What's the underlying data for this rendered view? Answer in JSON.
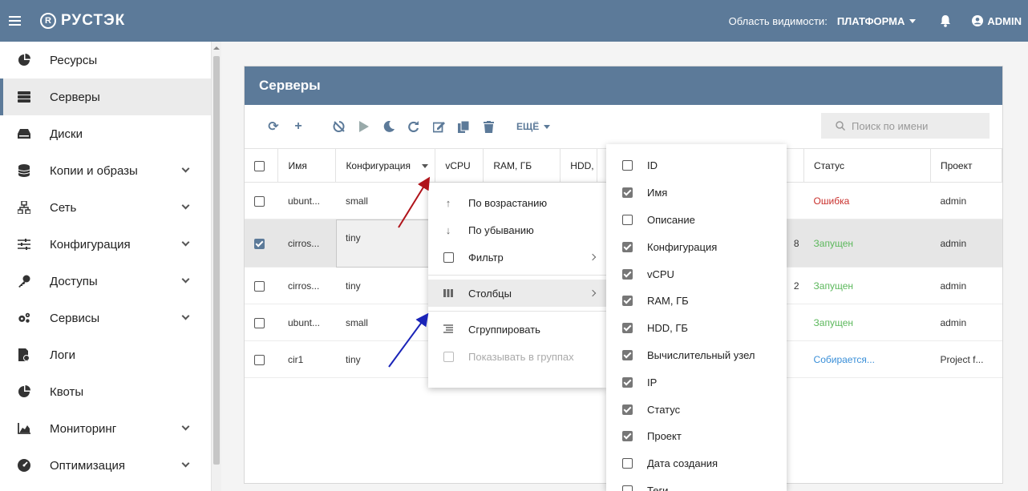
{
  "header": {
    "logo_text": "РУСТЭК",
    "logo_mark": "R",
    "scope_label": "Область видимости:",
    "scope_value": "ПЛАТФОРМА",
    "user": "ADMIN"
  },
  "sidebar": {
    "items": [
      {
        "label": "Ресурсы",
        "icon": "pie-chart-icon",
        "chevron": false
      },
      {
        "label": "Серверы",
        "icon": "server-icon",
        "chevron": false,
        "active": true
      },
      {
        "label": "Диски",
        "icon": "disk-icon",
        "chevron": false
      },
      {
        "label": "Копии и образы",
        "icon": "database-icon",
        "chevron": true
      },
      {
        "label": "Сеть",
        "icon": "network-icon",
        "chevron": true
      },
      {
        "label": "Конфигурация",
        "icon": "sliders-icon",
        "chevron": true
      },
      {
        "label": "Доступы",
        "icon": "key-icon",
        "chevron": true
      },
      {
        "label": "Сервисы",
        "icon": "cogs-icon",
        "chevron": true
      },
      {
        "label": "Логи",
        "icon": "log-icon",
        "chevron": false
      },
      {
        "label": "Квоты",
        "icon": "quota-icon",
        "chevron": false
      },
      {
        "label": "Мониторинг",
        "icon": "chart-icon",
        "chevron": true
      },
      {
        "label": "Оптимизация",
        "icon": "gauge-icon",
        "chevron": true
      }
    ]
  },
  "panel": {
    "title": "Серверы",
    "more_label": "ЕЩЁ",
    "search_placeholder": "Поиск по имени"
  },
  "table": {
    "columns": [
      "Имя",
      "Конфигурация",
      "vCPU",
      "RAM, ГБ",
      "HDD,",
      "Статус",
      "Проект"
    ],
    "rows": [
      {
        "name": "ubunt...",
        "config": "small",
        "partial": "",
        "status": "Ошибка",
        "status_type": "error",
        "project": "admin",
        "checked": false
      },
      {
        "name": "cirros...",
        "config": "tiny",
        "partial": "8",
        "status": "Запущен",
        "status_type": "run",
        "project": "admin",
        "checked": true
      },
      {
        "name": "cirros...",
        "config": "tiny",
        "partial": "2",
        "status": "Запущен",
        "status_type": "run",
        "project": "admin",
        "checked": false
      },
      {
        "name": "ubunt...",
        "config": "small",
        "partial": "",
        "status": "Запущен",
        "status_type": "run",
        "project": "admin",
        "checked": false
      },
      {
        "name": "cir1",
        "config": "tiny",
        "partial": "",
        "status": "Собирается...",
        "status_type": "build",
        "project": "Project f...",
        "checked": false
      }
    ]
  },
  "context_menu": {
    "sort_asc": "По возрастанию",
    "sort_desc": "По убыванию",
    "filter": "Фильтр",
    "columns": "Столбцы",
    "group": "Сгруппировать",
    "show_groups": "Показывать в группах"
  },
  "columns_menu": [
    {
      "label": "ID",
      "checked": false
    },
    {
      "label": "Имя",
      "checked": true
    },
    {
      "label": "Описание",
      "checked": false
    },
    {
      "label": "Конфигурация",
      "checked": true
    },
    {
      "label": "vCPU",
      "checked": true
    },
    {
      "label": "RAM, ГБ",
      "checked": true
    },
    {
      "label": "HDD, ГБ",
      "checked": true
    },
    {
      "label": "Вычислительный узел",
      "checked": true
    },
    {
      "label": "IP",
      "checked": true
    },
    {
      "label": "Статус",
      "checked": true
    },
    {
      "label": "Проект",
      "checked": true
    },
    {
      "label": "Дата создания",
      "checked": false
    },
    {
      "label": "Теги",
      "checked": false
    }
  ],
  "colors": {
    "brand": "#5c7a99",
    "error": "#c9302c",
    "running": "#5cb85c",
    "building": "#3a8fd8",
    "arrow_red": "#b0141b",
    "arrow_blue": "#1a24b8"
  }
}
